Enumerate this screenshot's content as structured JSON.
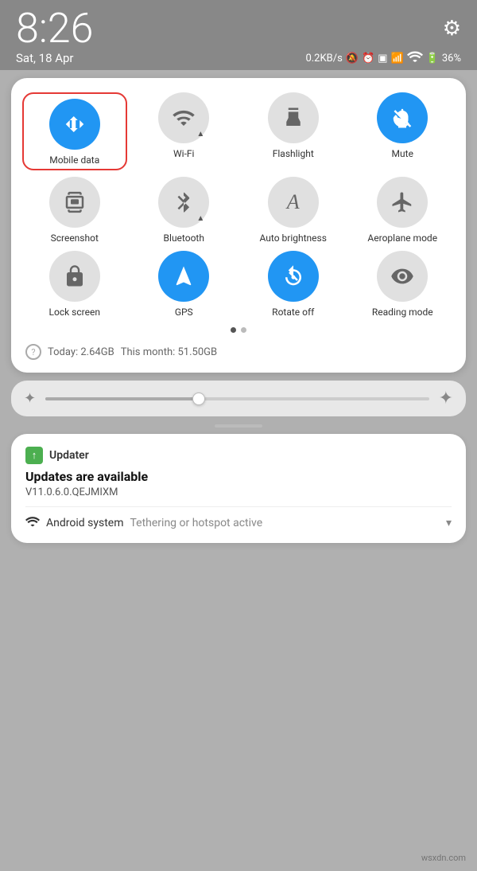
{
  "statusBar": {
    "time": "8:26",
    "date": "Sat, 18 Apr",
    "speed": "0.2KB/s",
    "battery": "36%"
  },
  "tiles": [
    {
      "id": "mobile-data",
      "label": "Mobile data",
      "icon": "arrows-updown",
      "active": true,
      "selected": true
    },
    {
      "id": "wifi",
      "label": "Wi-Fi",
      "icon": "wifi",
      "active": false,
      "hasArrow": true
    },
    {
      "id": "flashlight",
      "label": "Flashlight",
      "icon": "flashlight",
      "active": false
    },
    {
      "id": "mute",
      "label": "Mute",
      "icon": "bell-off",
      "active": true
    },
    {
      "id": "screenshot",
      "label": "Screenshot",
      "icon": "screenshot",
      "active": false
    },
    {
      "id": "bluetooth",
      "label": "Bluetooth",
      "icon": "bluetooth",
      "active": false,
      "hasArrow": true
    },
    {
      "id": "auto-brightness",
      "label": "Auto brightness",
      "icon": "letter-a",
      "active": false
    },
    {
      "id": "aeroplane",
      "label": "Aeroplane mode",
      "icon": "plane",
      "active": false
    },
    {
      "id": "lock-screen",
      "label": "Lock screen",
      "icon": "lock",
      "active": false
    },
    {
      "id": "gps",
      "label": "GPS",
      "icon": "location",
      "active": true
    },
    {
      "id": "rotate-off",
      "label": "Rotate off",
      "icon": "rotate",
      "active": true
    },
    {
      "id": "reading-mode",
      "label": "Reading mode",
      "icon": "eye",
      "active": false
    }
  ],
  "dots": [
    {
      "active": true
    },
    {
      "active": false
    }
  ],
  "dataUsage": {
    "today": "Today: 2.64GB",
    "month": "This month: 51.50GB"
  },
  "brightness": {
    "fillPercent": 40
  },
  "notification": {
    "appName": "Updater",
    "title": "Updates are available",
    "body": "V11.0.6.0.QEJMIXM",
    "secondary": {
      "appName": "Android system",
      "text": "Tethering or hotspot active",
      "chevron": "▾"
    }
  },
  "watermark": "wsxdn.com"
}
